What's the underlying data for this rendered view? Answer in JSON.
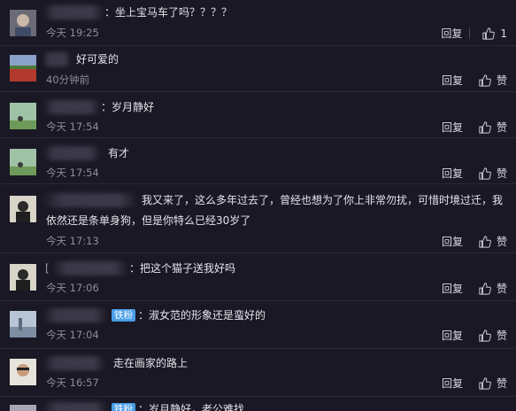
{
  "comments": [
    {
      "text": "：坐上宝马车了吗？？？？",
      "time": "今天 19:25",
      "reply": "回复",
      "like": "1"
    },
    {
      "text": "好可爱的",
      "time": "40分钟前",
      "reply": "回复",
      "like": "赞"
    },
    {
      "text": "：岁月静好",
      "time": "今天 17:54",
      "reply": "回复",
      "like": "赞"
    },
    {
      "text": "有才",
      "time": "今天 17:54",
      "reply": "回复",
      "like": "赞"
    },
    {
      "text_line1": "我又来了，这么多年过去了，曾经也想为了你上非常勿扰，可惜时境过迁，我",
      "text_line2": "依然还是条单身狗，但是你特么已经30岁了",
      "time": "今天 17:13",
      "reply": "回复",
      "like": "赞"
    },
    {
      "prefix": "[",
      "text": "：把这个猫子送我好吗",
      "time": "今天 17:06",
      "reply": "回复",
      "like": "赞"
    },
    {
      "badge": "铁粉",
      "text": "：淑女范的形象还是蛮好的",
      "time": "今天 17:04",
      "reply": "回复",
      "like": "赞"
    },
    {
      "text": "走在画家的路上",
      "time": "今天 16:57",
      "reply": "回复",
      "like": "赞"
    },
    {
      "badge": "铁粉",
      "text": "：岁月静好，老公难找",
      "time": "",
      "reply": "",
      "like": ""
    }
  ],
  "colors": {
    "background": "#1a1825",
    "badge": "#4a9ee8",
    "time": "#8e8c9c"
  }
}
